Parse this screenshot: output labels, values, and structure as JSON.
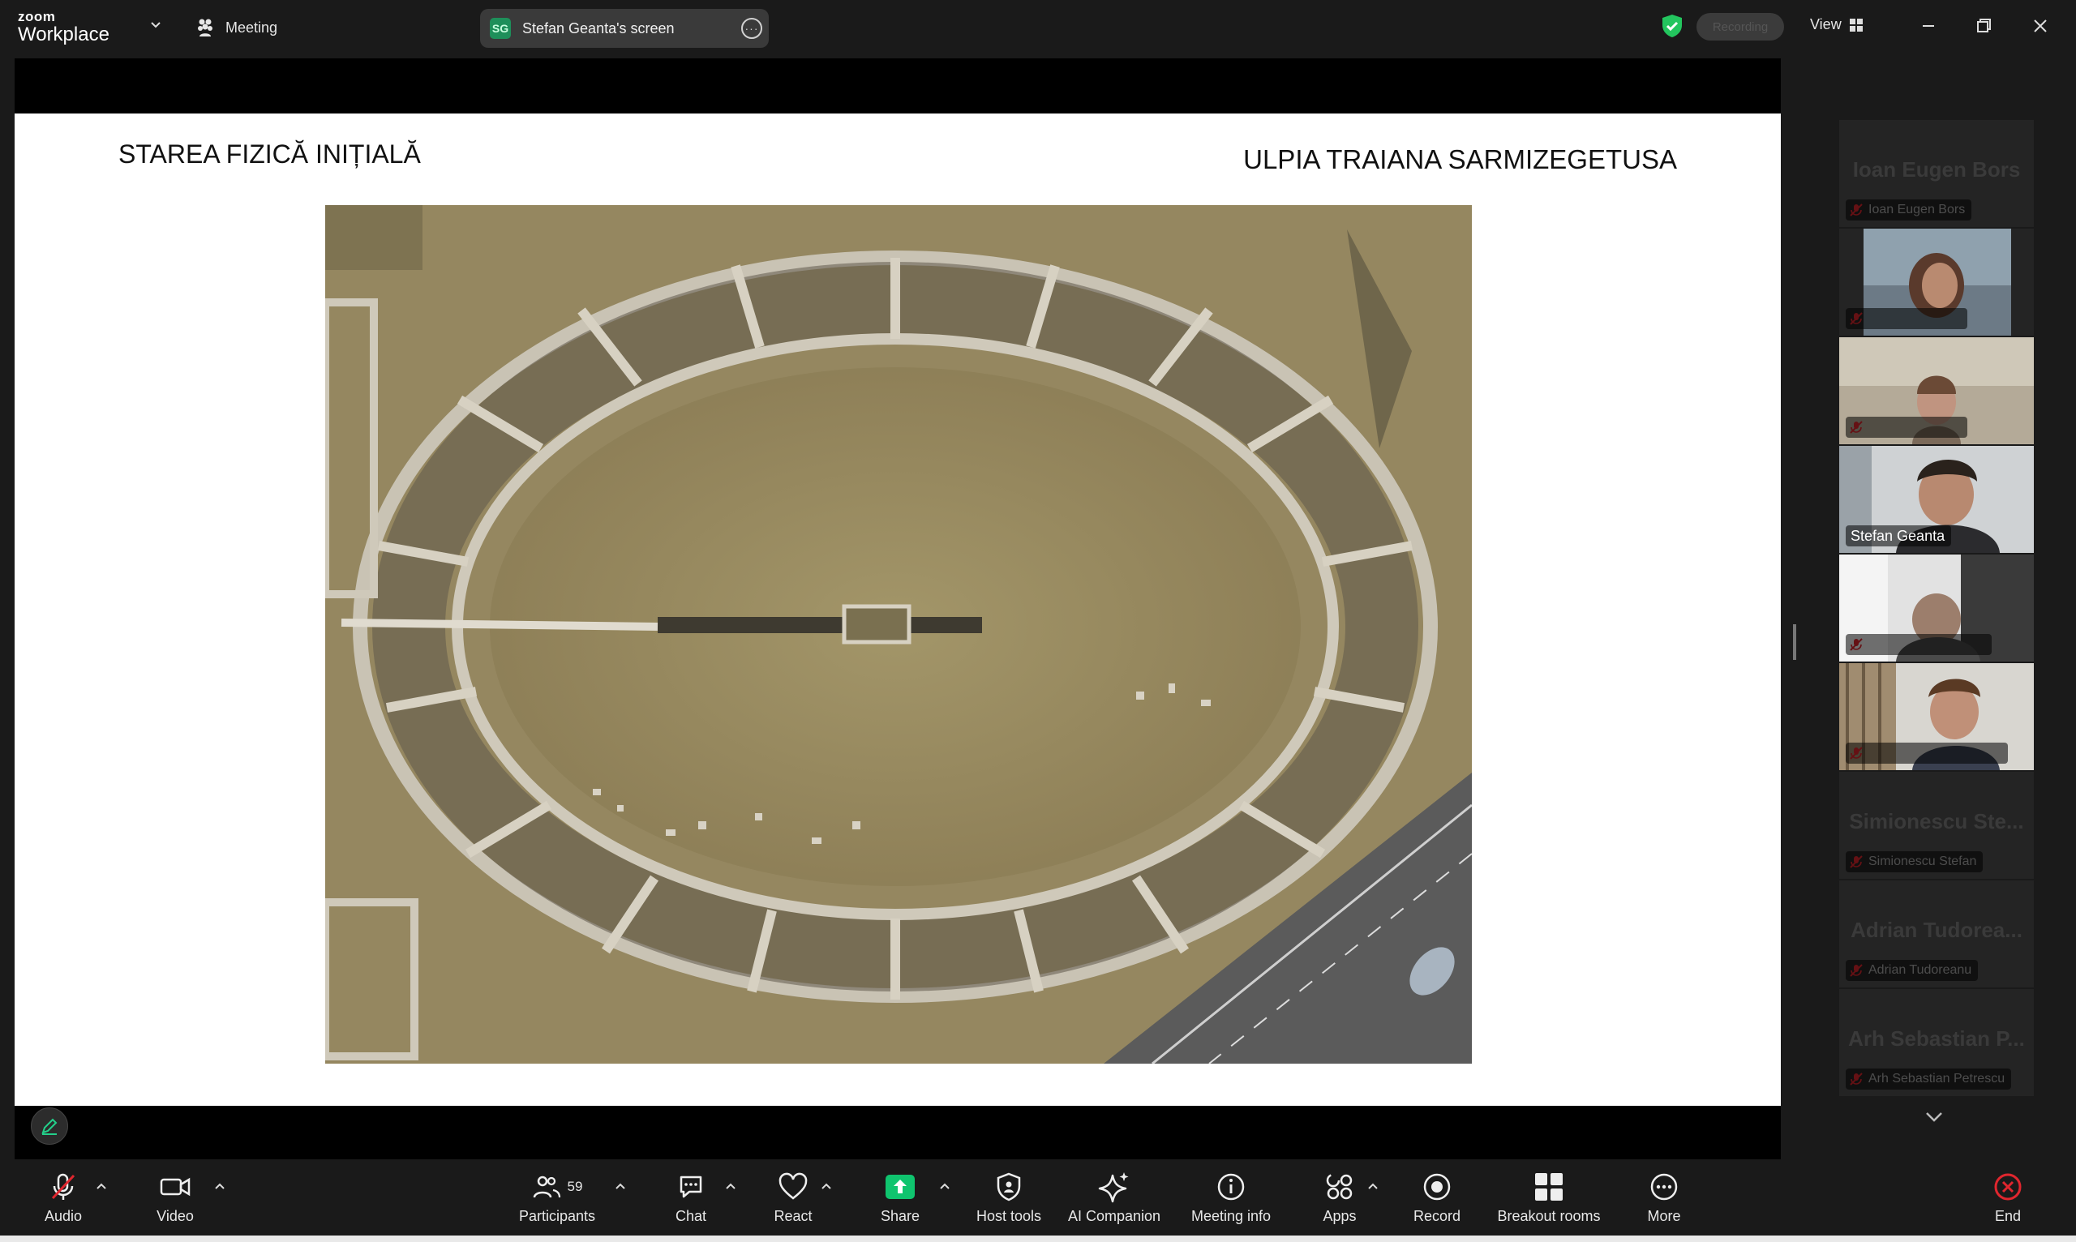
{
  "topbar": {
    "logo_line1": "zoom",
    "logo_line2": "Workplace",
    "meeting_label": "Meeting",
    "share_pill": {
      "initials": "SG",
      "label": "Stefan Geanta's screen"
    },
    "recording_label": "Recording",
    "view_label": "View"
  },
  "slide": {
    "title_left": "STAREA FIZICĂ INIȚIALĂ",
    "title_right": "ULPIA TRAIANA SARMIZEGETUSA"
  },
  "gallery": {
    "tiles": [
      {
        "big_name": "Ioan Eugen Bors",
        "tag": "Ioan Eugen Bors",
        "muted": true,
        "video": false
      },
      {
        "big_name": "",
        "tag": "",
        "muted": true,
        "video": true
      },
      {
        "big_name": "",
        "tag": "",
        "muted": true,
        "video": true
      },
      {
        "big_name": "",
        "tag": "Stefan Geanta",
        "muted": false,
        "video": true,
        "active": true
      },
      {
        "big_name": "",
        "tag": "",
        "muted": true,
        "video": true
      },
      {
        "big_name": "",
        "tag": "",
        "muted": true,
        "video": true
      },
      {
        "big_name": "Simionescu Ste...",
        "tag": "Simionescu Stefan",
        "muted": true,
        "video": false
      },
      {
        "big_name": "Adrian Tudorea...",
        "tag": "Adrian Tudoreanu",
        "muted": true,
        "video": false
      },
      {
        "big_name": "Arh Sebastian P...",
        "tag": "Arh Sebastian Petrescu",
        "muted": true,
        "video": false
      }
    ]
  },
  "toolbar": {
    "audio": "Audio",
    "video": "Video",
    "participants": "Participants",
    "participants_count": "59",
    "chat": "Chat",
    "react": "React",
    "share": "Share",
    "host_tools": "Host tools",
    "ai_companion": "AI Companion",
    "meeting_info": "Meeting info",
    "apps": "Apps",
    "record": "Record",
    "breakout_rooms": "Breakout rooms",
    "more": "More",
    "end": "End"
  },
  "colors": {
    "background": "#1a1a1a",
    "active_speaker": "#23d18b",
    "share_green": "#0fc46e",
    "end_red": "#e0262e",
    "mute_red": "#e0262e"
  }
}
